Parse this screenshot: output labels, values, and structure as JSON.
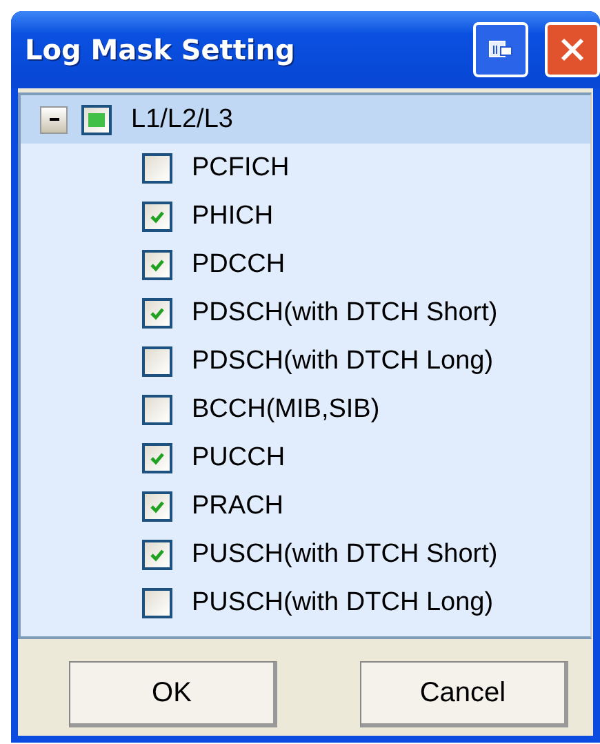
{
  "window": {
    "title": "Log Mask Setting"
  },
  "tree": {
    "label": "L1/L2/L3",
    "expanded": true,
    "mixed": true,
    "selected": true,
    "children": [
      {
        "label": "PCFICH",
        "checked": false
      },
      {
        "label": "PHICH",
        "checked": true
      },
      {
        "label": "PDCCH",
        "checked": true
      },
      {
        "label": "PDSCH(with DTCH Short)",
        "checked": true
      },
      {
        "label": "PDSCH(with DTCH Long)",
        "checked": false
      },
      {
        "label": "BCCH(MIB,SIB)",
        "checked": false
      },
      {
        "label": "PUCCH",
        "checked": true
      },
      {
        "label": "PRACH",
        "checked": true
      },
      {
        "label": "PUSCH(with DTCH Short)",
        "checked": true
      },
      {
        "label": "PUSCH(with DTCH Long)",
        "checked": false
      }
    ]
  },
  "buttons": [
    "OK",
    "Cancel"
  ]
}
